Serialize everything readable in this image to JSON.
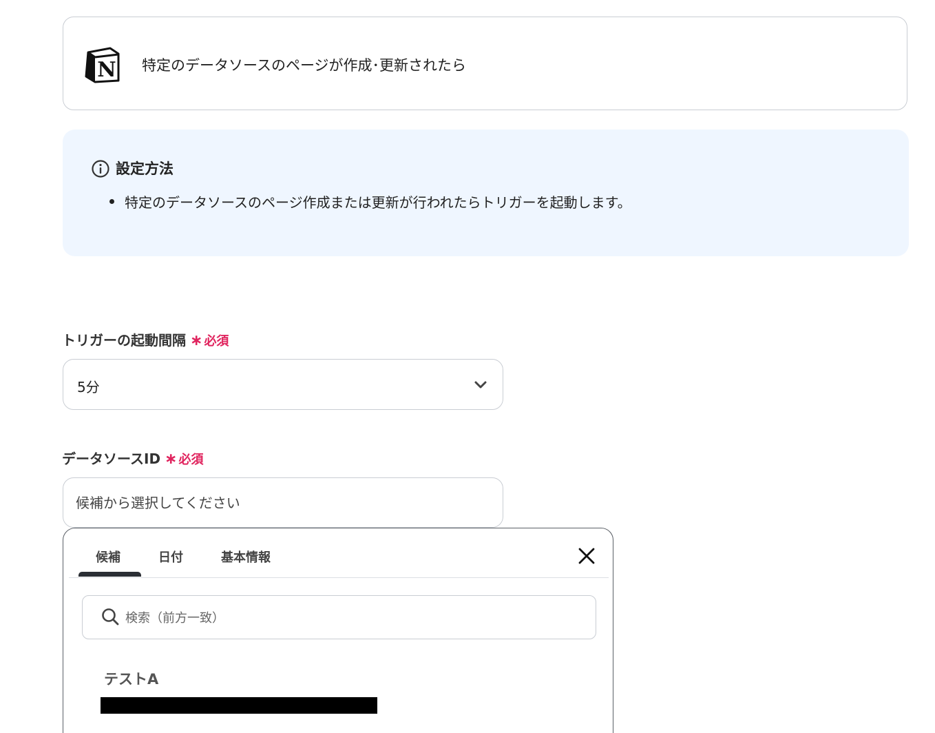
{
  "trigger": {
    "app_icon": "notion-icon",
    "title": "特定のデータソースのページが作成･更新されたら"
  },
  "info": {
    "icon": "info-icon",
    "title": "設定方法",
    "items": [
      "特定のデータソースのページ作成または更新が行われたらトリガーを起動します。"
    ]
  },
  "fields": {
    "interval": {
      "label": "トリガーの起動間隔",
      "required_star": "∗",
      "required_text": "必須",
      "value": "5分"
    },
    "datasource": {
      "label": "データソースID",
      "required_star": "∗",
      "required_text": "必須",
      "placeholder": "候補から選択してください"
    }
  },
  "dropdown": {
    "tabs": [
      {
        "label": "候補",
        "active": true
      },
      {
        "label": "日付",
        "active": false
      },
      {
        "label": "基本情報",
        "active": false
      }
    ],
    "search_placeholder": "検索（前方一致）",
    "items": [
      {
        "title": "テストA"
      }
    ]
  },
  "colors": {
    "required": "#e0245e",
    "info_bg": "#eff6ff",
    "border": "#c9cdd3"
  }
}
